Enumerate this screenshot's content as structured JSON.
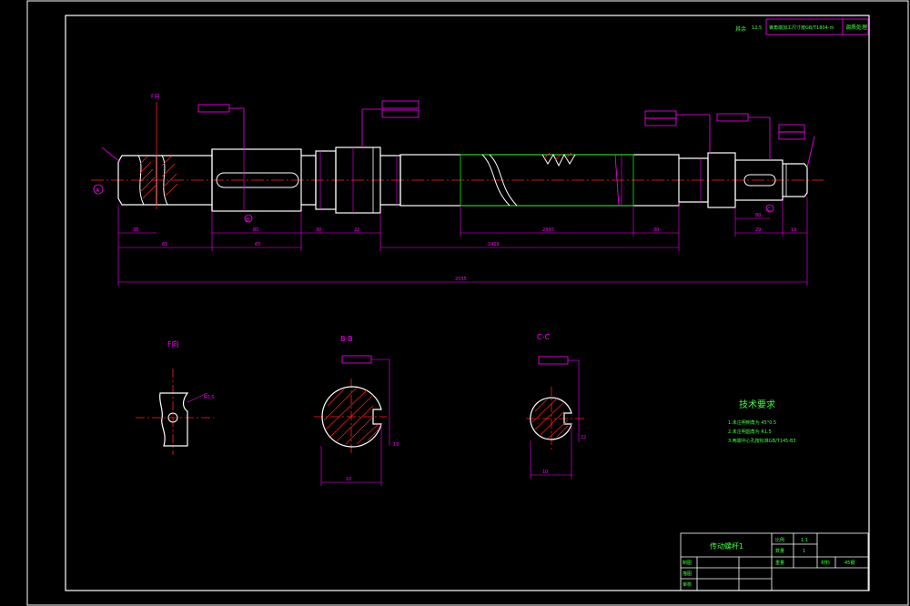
{
  "colors": {
    "background": "#000000",
    "frame": "#ffffff",
    "dimension": "#ff00ff",
    "centerline": "#ff2020",
    "hatch": "#ff2020",
    "hidden": "#00c800",
    "note_text": "#40ff40",
    "title_text": "#40ff40"
  },
  "top_note": {
    "roughness_label": "其余",
    "roughness_value": "12.5",
    "requirement": "锥角端加工尺寸按GB/T1804-m",
    "inspection": "调质处理"
  },
  "views": {
    "f_section": "F向",
    "b_section": "B-B",
    "c_section": "C-C"
  },
  "main_labels": {
    "datum_a": "A",
    "section_b_mark": "B",
    "section_c_mark": "C",
    "f_mark": "F向"
  },
  "dimensions": {
    "seg_1": "38",
    "seg_2": "65",
    "seg_3": "80",
    "seg_4": "30",
    "seg_5": "22",
    "seg_6": "2330",
    "seg_7": "30",
    "seg_8": "80",
    "seg_9": "29",
    "seg_10": "13",
    "sum_1": "65",
    "sum_2": "65",
    "sum_3": "2419",
    "overall": "2555",
    "b_width": "10",
    "b_depth": "19",
    "c_width": "10",
    "c_depth": "22",
    "f_angle": "R0.5"
  },
  "tech_requirements": {
    "title": "技术要求",
    "items": [
      "1.未注明倒角为 45°0.5",
      "2.未注明圆角为 R1.5",
      "3.两端中心孔按标准GB/T145-B3"
    ]
  },
  "title_block": {
    "part_name": "传动螺杆1",
    "scale_label": "比例",
    "scale_value": "1:1",
    "qty_label": "数量",
    "qty_value": "1",
    "weight_label": "重量",
    "material_label": "材料",
    "material_value": "45钢",
    "designer_label": "制图",
    "checker_label": "描图",
    "reviewer_label": "审核"
  }
}
